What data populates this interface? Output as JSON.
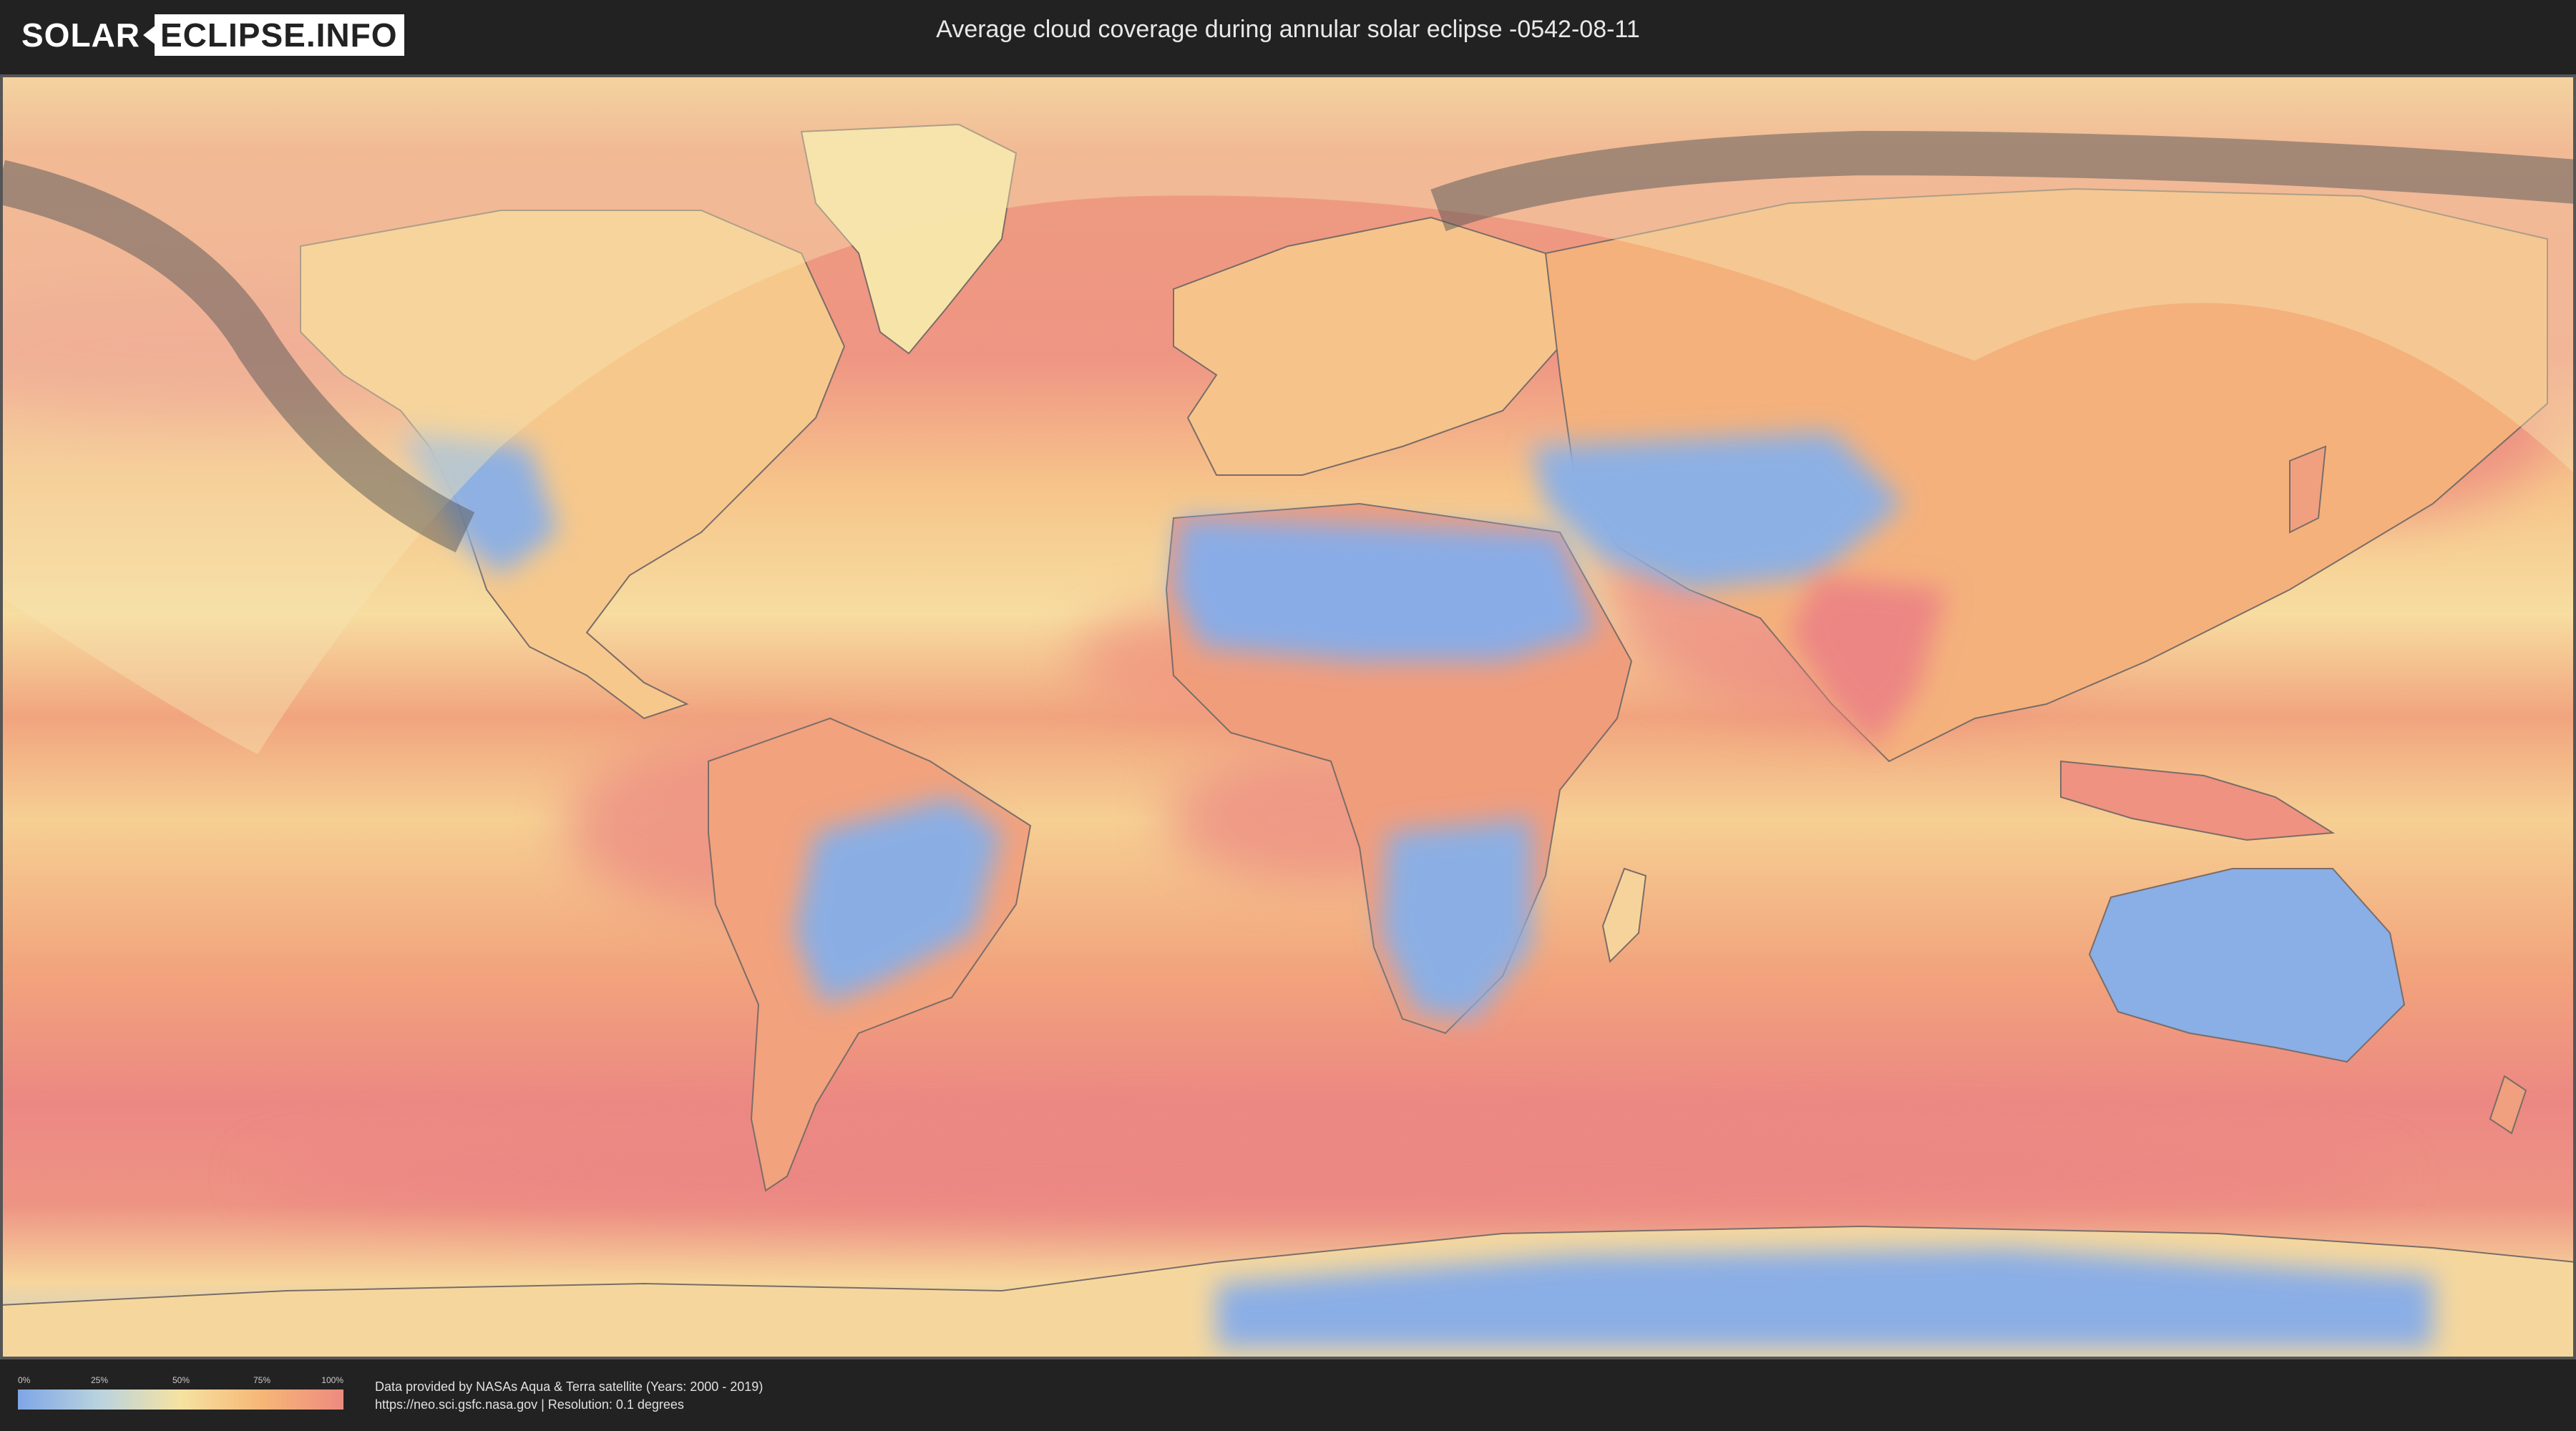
{
  "header": {
    "logo_left": "SOLAR",
    "logo_right": "ECLIPSE.INFO",
    "title": "Average cloud coverage during annular solar eclipse -0542-08-11"
  },
  "legend": {
    "ticks": [
      "0%",
      "25%",
      "50%",
      "75%",
      "100%"
    ],
    "colors": [
      "#7fa5e6",
      "#b9d3df",
      "#f6e2a0",
      "#f6b676",
      "#ee8a80"
    ]
  },
  "credits": {
    "line1": "Data provided by NASAs Aqua & Terra satellite (Years: 2000 - 2019)",
    "line2": "https://neo.sci.gsfc.nasa.gov | Resolution: 0.1 degrees"
  },
  "map": {
    "ocean_color": "#f4ae7b",
    "clear_color": "#8aaee6",
    "cloudy_color": "#ec8a84",
    "overlay_color": "#f5e6b4",
    "path_color": "#555555"
  }
}
